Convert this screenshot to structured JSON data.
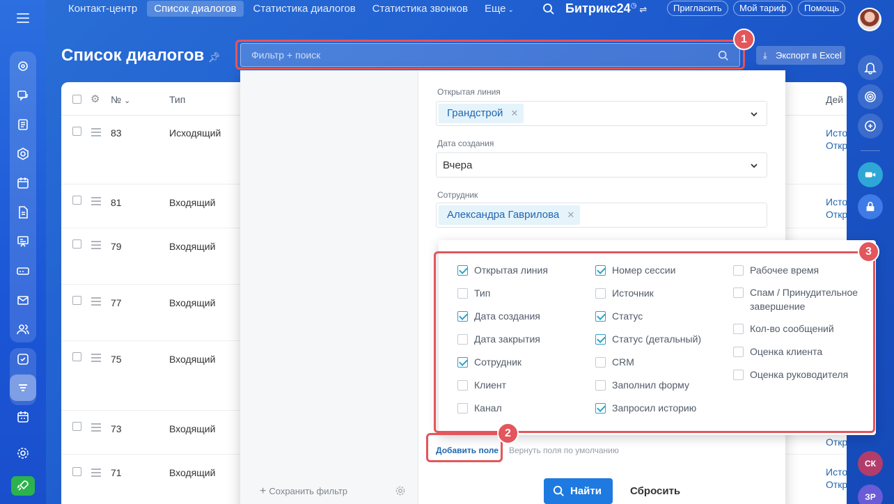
{
  "nav": {
    "tabs": [
      "Контакт-центр",
      "Список диалогов",
      "Статистика диалогов",
      "Статистика звонков",
      "Еще"
    ],
    "brand": "Битрикс24",
    "invite": "Пригласить",
    "tariff": "Мой тариф",
    "help": "Помощь"
  },
  "page": {
    "title": "Список диалогов",
    "filter_placeholder": "Фильтр + поиск",
    "export": "Экспорт в Excel"
  },
  "badges": [
    "1",
    "2",
    "3"
  ],
  "table": {
    "headers": {
      "num": "№",
      "type": "Тип",
      "actions": "Дей"
    },
    "rows": [
      {
        "num": "83",
        "type": "Исходящий",
        "link1": "Исто",
        "link2": "Откр"
      },
      {
        "num": "81",
        "type": "Входящий",
        "link1": "Исто",
        "link2": "Откр"
      },
      {
        "num": "79",
        "type": "Входящий"
      },
      {
        "num": "77",
        "type": "Входящий"
      },
      {
        "num": "75",
        "type": "Входящий"
      },
      {
        "num": "73",
        "type": "Входящий",
        "link1": "Откр"
      },
      {
        "num": "71",
        "type": "Входящий",
        "link1": "Исто",
        "link2": "Откр"
      }
    ]
  },
  "filter_panel": {
    "save_filter": "Сохранить фильтр",
    "fields": [
      {
        "label": "Открытая линия",
        "tag": "Грандстрой"
      },
      {
        "label": "Дата создания",
        "value": "Вчера"
      },
      {
        "label": "Сотрудник",
        "tag": "Александра Гаврилова"
      }
    ],
    "add_field": "Добавить поле",
    "restore": "Вернуть поля по умолчанию",
    "find": "Найти",
    "reset": "Сбросить"
  },
  "field_chooser": {
    "columns": [
      [
        {
          "label": "Открытая линия",
          "checked": true
        },
        {
          "label": "Тип",
          "checked": false
        },
        {
          "label": "Дата создания",
          "checked": true
        },
        {
          "label": "Дата закрытия",
          "checked": false
        },
        {
          "label": "Сотрудник",
          "checked": true
        },
        {
          "label": "Клиент",
          "checked": false
        },
        {
          "label": "Канал",
          "checked": false
        }
      ],
      [
        {
          "label": "Номер сессии",
          "checked": true
        },
        {
          "label": "Источник",
          "checked": false
        },
        {
          "label": "Статус",
          "checked": true
        },
        {
          "label": "Статус (детальный)",
          "checked": true
        },
        {
          "label": "CRM",
          "checked": false
        },
        {
          "label": "Заполнил форму",
          "checked": false
        },
        {
          "label": "Запросил историю",
          "checked": true
        }
      ],
      [
        {
          "label": "Рабочее время",
          "checked": false
        },
        {
          "label": "Спам / Принудительное завершение",
          "checked": false
        },
        {
          "label": "Кол-во сообщений",
          "checked": false
        },
        {
          "label": "Оценка клиента",
          "checked": false
        },
        {
          "label": "Оценка руководителя",
          "checked": false
        }
      ]
    ]
  },
  "right_avatars": [
    "СК",
    "ЗР"
  ],
  "colors": {
    "accent": "#1e7ae0",
    "highlight": "#e2565c",
    "link": "#2067b0",
    "check": "#2fa2c7"
  }
}
